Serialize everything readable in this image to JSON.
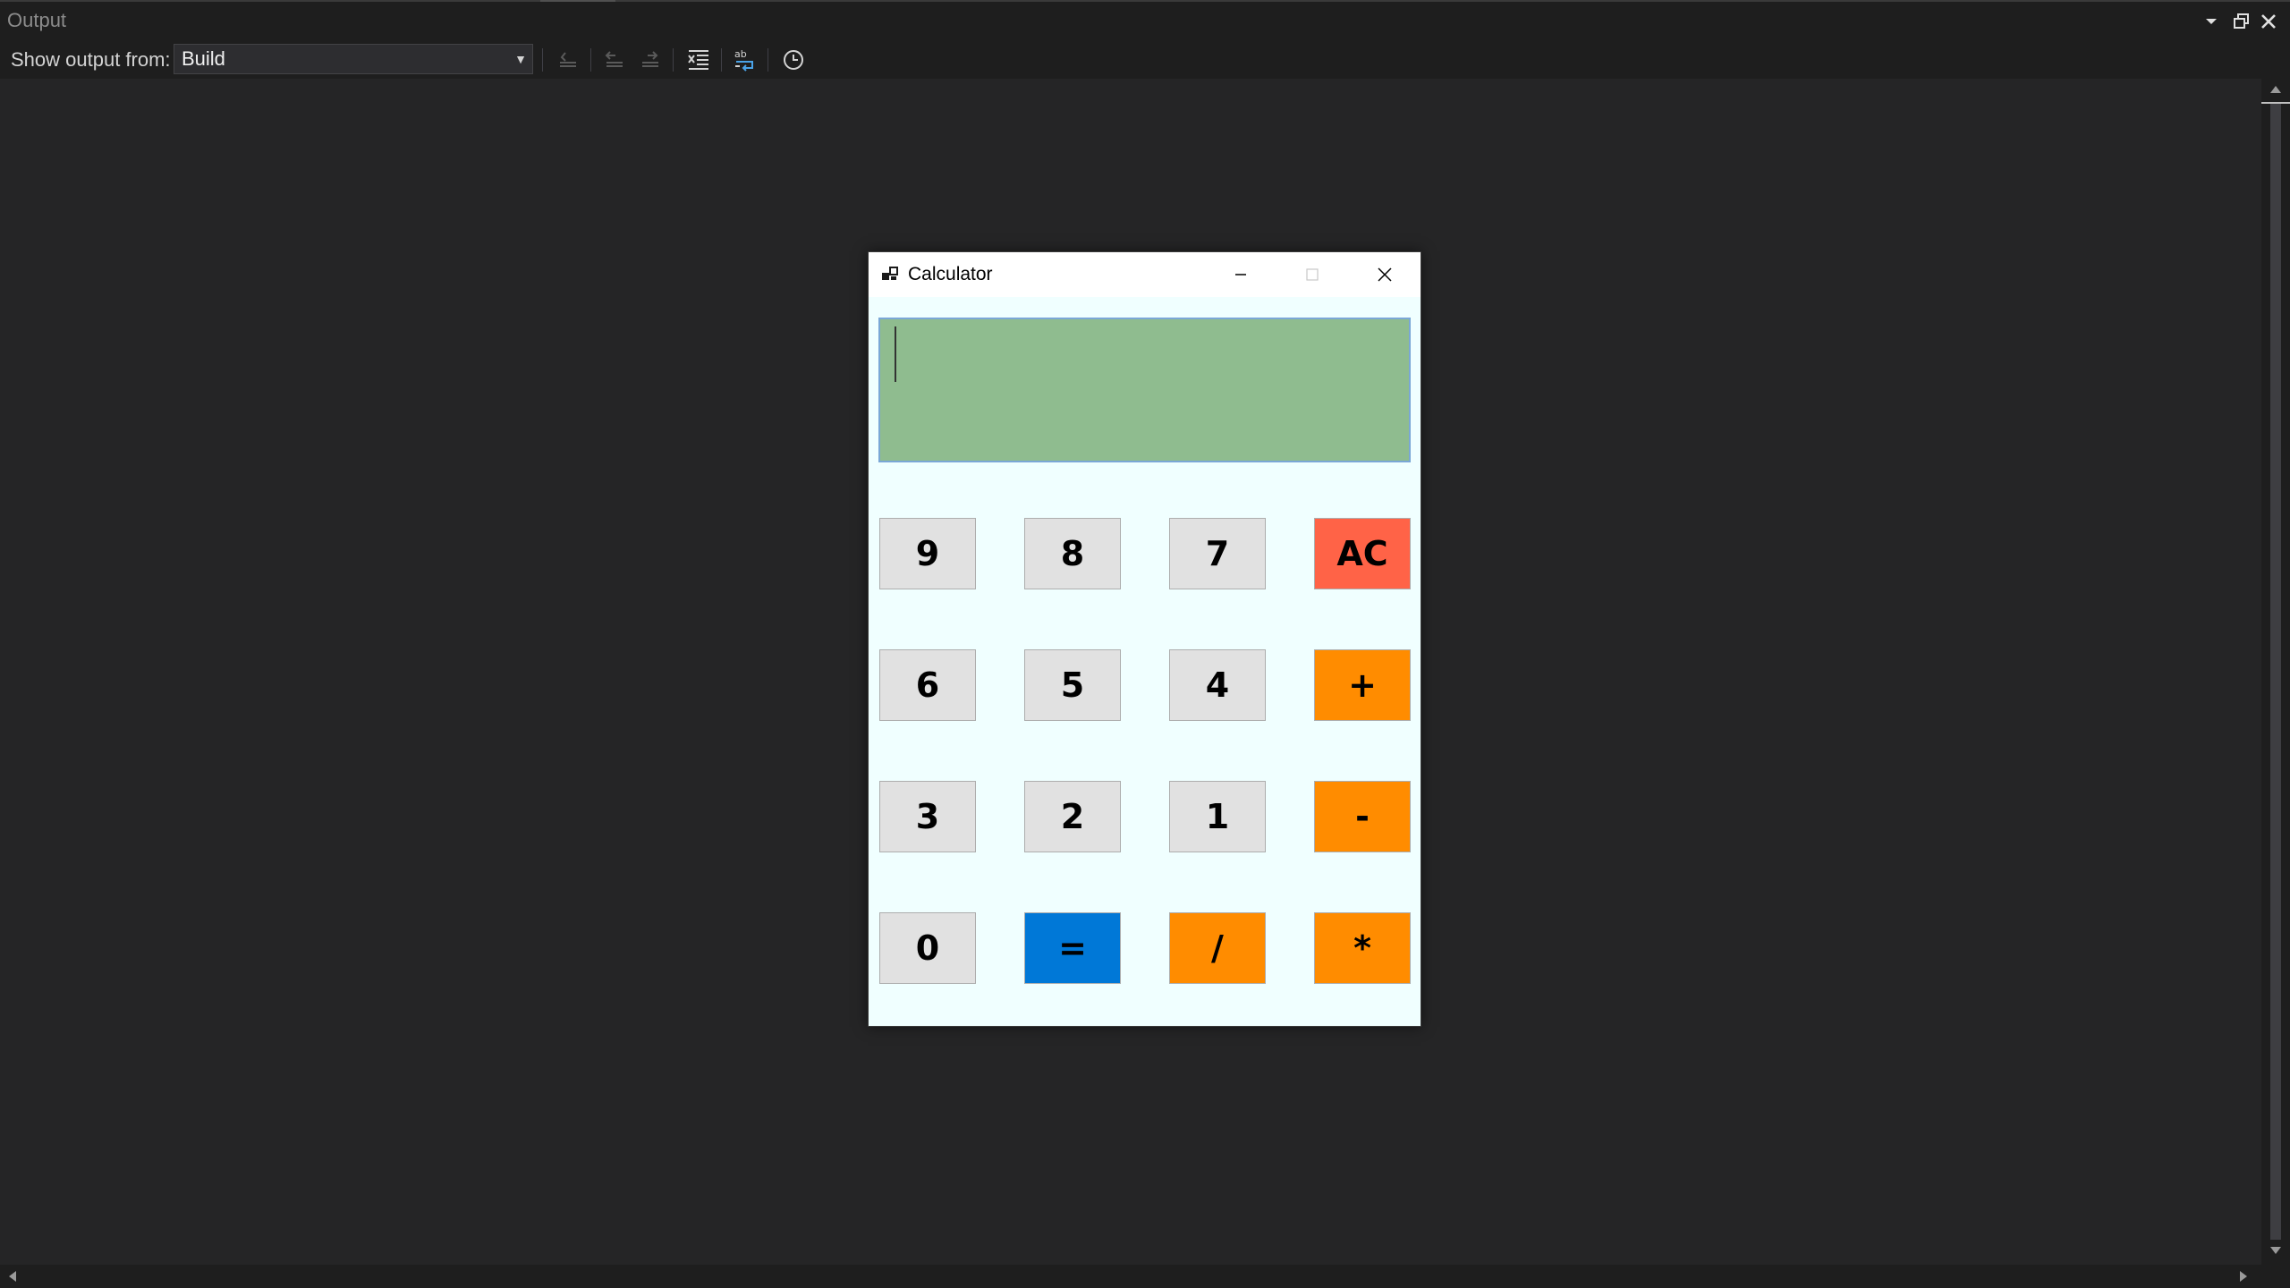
{
  "panel": {
    "title": "Output",
    "show_output_label": "Show output from:",
    "source_selected": "Build",
    "toolbar_icons": [
      "go-to-previous-message-icon",
      "go-to-previous-icon",
      "go-to-next-icon",
      "clear-all-icon",
      "toggle-word-wrap-icon",
      "toggle-timestamp-icon"
    ],
    "controls": [
      "window-position-icon",
      "maximize-panel-icon",
      "close-panel-icon"
    ]
  },
  "calculator": {
    "title": "Calculator",
    "display_value": "",
    "keys": {
      "k9": "9",
      "k8": "8",
      "k7": "7",
      "ac": "AC",
      "k6": "6",
      "k5": "5",
      "k4": "4",
      "plus": "+",
      "k3": "3",
      "k2": "2",
      "k1": "1",
      "minus": "-",
      "k0": "0",
      "equals": "=",
      "divide": "/",
      "multiply": "*"
    }
  },
  "colors": {
    "display_background": "#8fbc8f",
    "digit_key": "#e1e1e1",
    "operator_key": "#ff8c00",
    "clear_key": "#ff6347",
    "equals_key": "#0078d7",
    "form_background": "#f0ffff"
  }
}
